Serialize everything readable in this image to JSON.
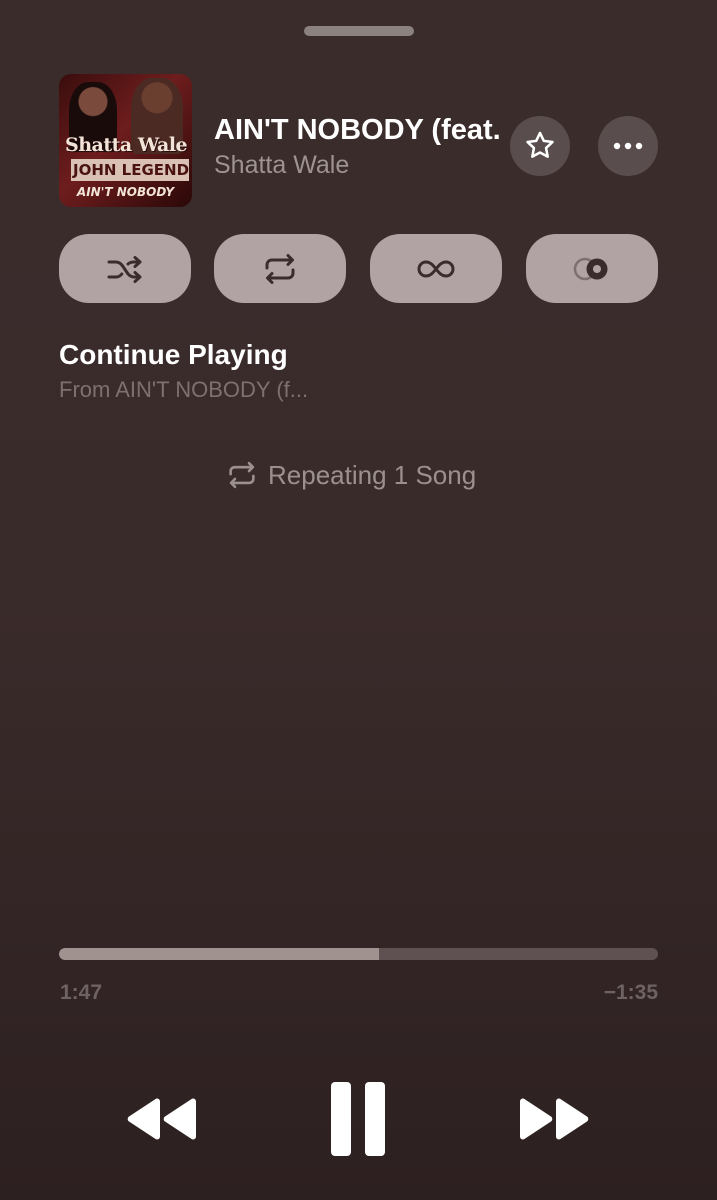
{
  "now_playing": {
    "title": "AIN'T NOBODY (feat. John Legend)",
    "artist": "Shatta Wale",
    "artwork": {
      "line1": "Shatta Wale",
      "line2": "JOHN LEGEND",
      "line3": "AIN'T NOBODY"
    }
  },
  "actions": {
    "star_icon": "star-icon",
    "more_icon": "ellipsis-icon"
  },
  "mode_buttons": [
    {
      "icon": "shuffle-icon"
    },
    {
      "icon": "repeat-icon"
    },
    {
      "icon": "infinity-icon"
    },
    {
      "icon": "crossfade-icon"
    }
  ],
  "queue": {
    "heading": "Continue Playing",
    "source": "From AIN'T NOBODY (f..."
  },
  "repeat_status": {
    "icon": "repeat-icon",
    "text": "Repeating 1 Song"
  },
  "playback": {
    "elapsed": "1:47",
    "remaining": "−1:35",
    "progress_fraction": 0.535
  },
  "controls": {
    "rewind_icon": "rewind-icon",
    "pause_icon": "pause-icon",
    "forward_icon": "fast-forward-icon"
  },
  "colors": {
    "background": "#3b2c2c",
    "pill": "#b1a3a3",
    "secondary_text": "#9e9292"
  }
}
